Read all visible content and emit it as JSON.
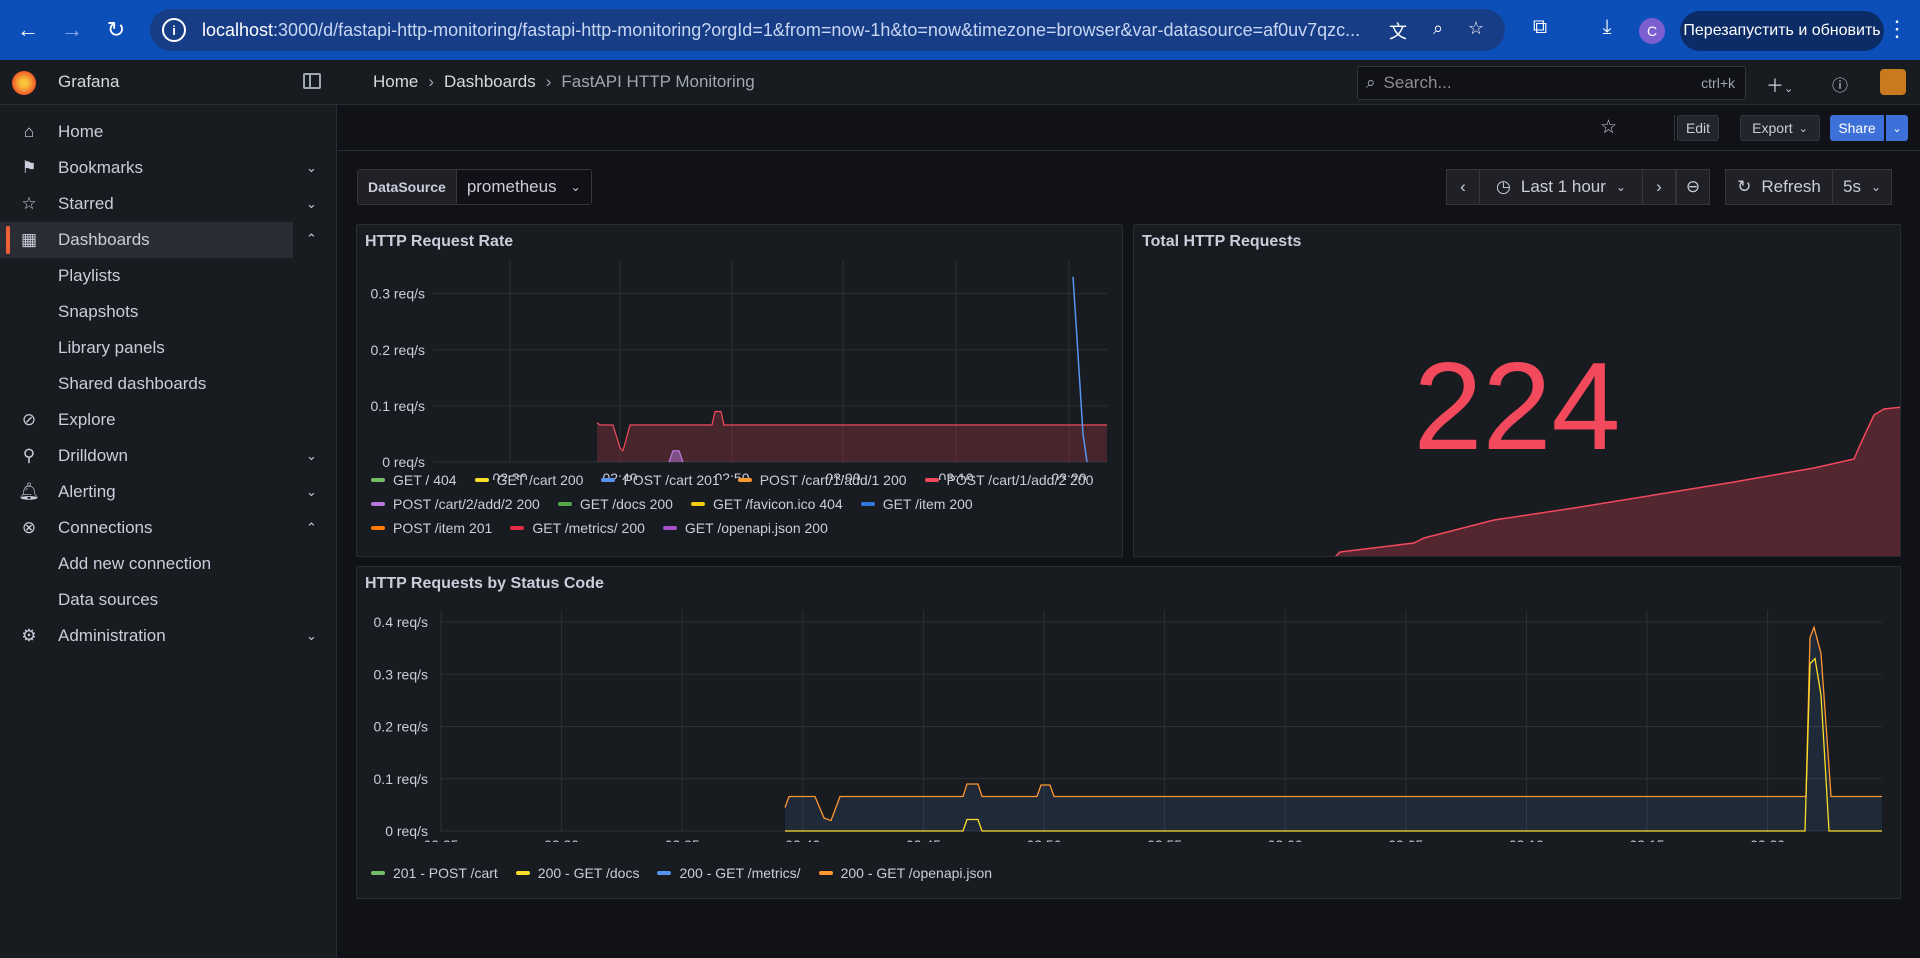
{
  "browser": {
    "url_host": "localhost",
    "url_path": ":3000/d/fastapi-http-monitoring/fastapi-http-monitoring?orgId=1&from=now-1h&to=now&timezone=browser&var-datasource=af0uv7qzc...",
    "profile_initial": "C",
    "update_button": "Перезапустить и обновить"
  },
  "app": {
    "brand": "Grafana"
  },
  "breadcrumb": [
    "Home",
    "Dashboards",
    "FastAPI HTTP Monitoring"
  ],
  "search": {
    "placeholder": "Search...",
    "shortcut": "ctrl+k"
  },
  "sidebar": {
    "items": [
      {
        "label": "Home",
        "icon": "home-icon"
      },
      {
        "label": "Bookmarks",
        "icon": "bookmark-icon"
      },
      {
        "label": "Starred",
        "icon": "star-icon"
      },
      {
        "label": "Dashboards",
        "icon": "dashboards-icon",
        "active": true
      },
      {
        "label": "Playlists"
      },
      {
        "label": "Snapshots"
      },
      {
        "label": "Library panels"
      },
      {
        "label": "Shared dashboards"
      },
      {
        "label": "Explore",
        "icon": "compass-icon"
      },
      {
        "label": "Drilldown",
        "icon": "drilldown-icon"
      },
      {
        "label": "Alerting",
        "icon": "bell-icon"
      },
      {
        "label": "Connections",
        "icon": "connections-icon"
      },
      {
        "label": "Add new connection"
      },
      {
        "label": "Data sources"
      },
      {
        "label": "Administration",
        "icon": "gear-icon"
      }
    ]
  },
  "toolbar": {
    "edit": "Edit",
    "export": "Export",
    "share": "Share"
  },
  "variables": {
    "label": "DataSource",
    "value": "prometheus"
  },
  "time": {
    "range": "Last 1 hour",
    "refresh": "Refresh",
    "interval": "5s"
  },
  "panels": {
    "rate_title": "HTTP Request Rate",
    "total_title": "Total HTTP Requests",
    "total_value": "224",
    "status_title": "HTTP Requests by Status Code"
  },
  "colors": {
    "red": "#f2495c",
    "orange": "#ff9830",
    "yellow": "#fade2a",
    "blue": "#5794f2",
    "green": "#73bf69",
    "purple": "#b877d9"
  },
  "chart_data": [
    {
      "type": "line",
      "title": "HTTP Request Rate",
      "x_ticks": [
        "02:30",
        "02:40",
        "02:50",
        "03:00",
        "03:10",
        "03:20"
      ],
      "y_ticks": [
        "0 req/s",
        "0.1 req/s",
        "0.2 req/s",
        "0.3 req/s"
      ],
      "ylim": [
        0,
        0.36
      ],
      "series": [
        {
          "name": "GET / 404",
          "color": "#73bf69"
        },
        {
          "name": "GET /cart 200",
          "color": "#fade2a"
        },
        {
          "name": "POST /cart 201",
          "color": "#5794f2"
        },
        {
          "name": "POST /cart/1/add/1 200",
          "color": "#ff9830"
        },
        {
          "name": "POST /cart/1/add/2 200",
          "color": "#f2495c"
        },
        {
          "name": "POST /cart/2/add/2 200",
          "color": "#b877d9"
        },
        {
          "name": "GET /docs 200",
          "color": "#56a64b"
        },
        {
          "name": "GET /favicon.ico 404",
          "color": "#f2cc0c"
        },
        {
          "name": "GET /item 200",
          "color": "#3274d9"
        },
        {
          "name": "POST /item 201",
          "color": "#ff780a"
        },
        {
          "name": "GET /metrics/ 200",
          "color": "#e02f44"
        },
        {
          "name": "GET /openapi.json 200",
          "color": "#a352cc"
        }
      ]
    },
    {
      "type": "line",
      "title": "HTTP Requests by Status Code",
      "x_ticks": [
        "02:25",
        "02:30",
        "02:35",
        "02:40",
        "02:45",
        "02:50",
        "02:55",
        "03:00",
        "03:05",
        "03:10",
        "03:15",
        "03:20"
      ],
      "y_ticks": [
        "0 req/s",
        "0.1 req/s",
        "0.2 req/s",
        "0.3 req/s",
        "0.4 req/s"
      ],
      "ylim": [
        0,
        0.4
      ],
      "series": [
        {
          "name": "201 - POST /cart",
          "color": "#73bf69"
        },
        {
          "name": "200 - GET /docs",
          "color": "#fade2a"
        },
        {
          "name": "200 - GET /metrics/",
          "color": "#5794f2"
        },
        {
          "name": "200 - GET /openapi.json",
          "color": "#ff9830"
        }
      ]
    }
  ]
}
